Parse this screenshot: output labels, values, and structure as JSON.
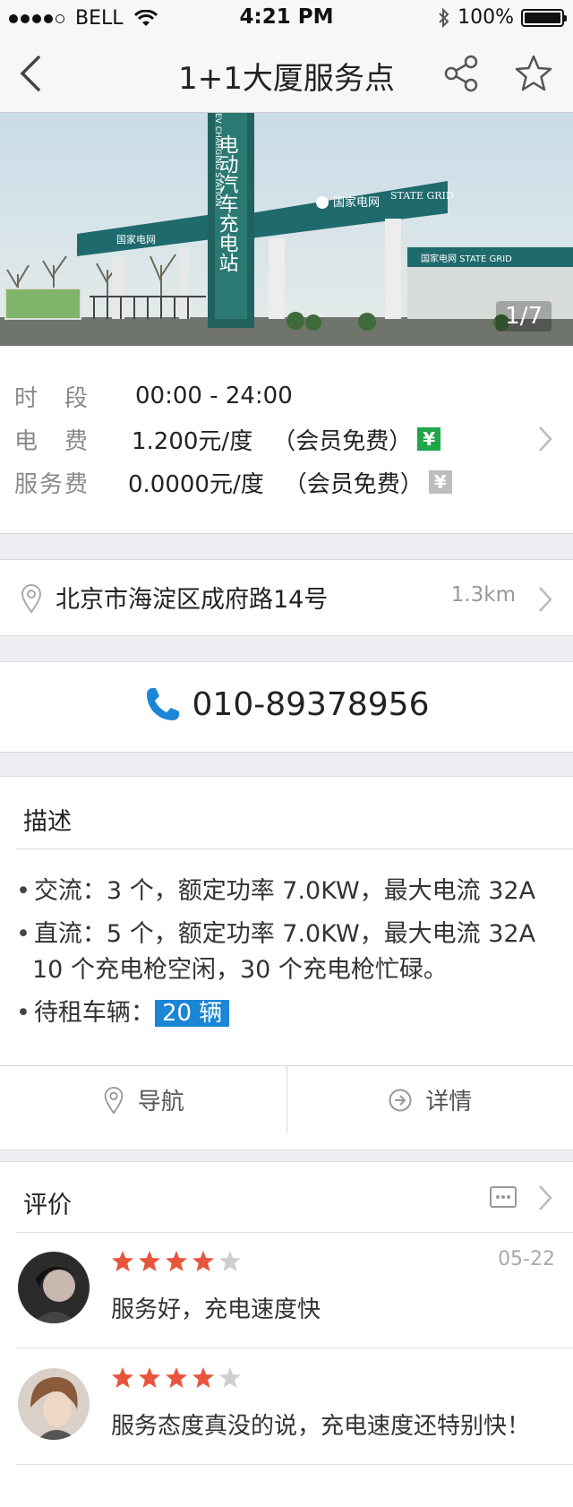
{
  "status_bar": {
    "carrier": "BELL",
    "time": "4:21 PM",
    "battery": "100%"
  },
  "nav": {
    "title": "1+1大厦服务点",
    "back_icon": "chevron-left-icon",
    "share_icon": "share-icon",
    "favorite_icon": "star-outline-icon"
  },
  "hero": {
    "counter": "1/7",
    "sign_vertical": "电动汽车充电站",
    "sign_en": "EV CHARGING STATION",
    "canopy_cn": "国家电网",
    "canopy_en": "STATE GRID"
  },
  "fees": {
    "time_label": "时　段",
    "time_value": "00:00 - 24:00",
    "elec_label": "电　费",
    "elec_value": "1.200元/度",
    "elec_note": "（会员免费）",
    "service_label": "服务费",
    "service_value": "0.0000元/度",
    "service_note": "（会员免费）",
    "yen": "¥",
    "yen_color_active": "#1fa64b",
    "yen_color_inactive": "#bdbdbd"
  },
  "address": {
    "text": "北京市海淀区成府路14号",
    "distance": "1.3km"
  },
  "phone": {
    "number": "010-89378956",
    "icon_color": "#1b86d6"
  },
  "description": {
    "title": "描述",
    "ac": "交流：3 个，额定功率 7.0KW，最大电流 32A",
    "dc": "直流：5 个，额定功率 7.0KW，最大电流 32A",
    "dc_status": "10 个充电枪空闲，30 个充电枪忙碌。",
    "rental_label": "待租车辆：",
    "rental_value": "20 辆"
  },
  "actions": {
    "navigate": "导航",
    "details": "详情"
  },
  "reviews": {
    "title": "评价",
    "items": [
      {
        "rating": 4,
        "date": "05-22",
        "text": "服务好，充电速度快"
      },
      {
        "rating": 4,
        "date": "",
        "text": "服务态度真没的说，充电速度还特别快！"
      }
    ],
    "star_color": "#e8553d",
    "star_empty_color": "#cfcfcf"
  }
}
